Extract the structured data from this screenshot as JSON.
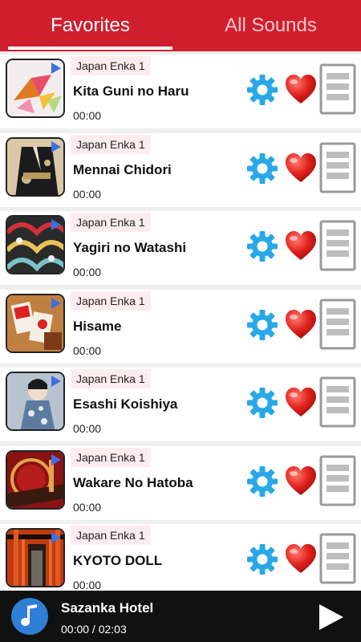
{
  "tabs": [
    {
      "label": "Favorites",
      "active": true
    },
    {
      "label": "All Sounds",
      "active": false
    }
  ],
  "songs": [
    {
      "category": "Japan Enka 1",
      "title": "Kita Guni no Haru",
      "time": "00:00",
      "thumb": "origami-cranes"
    },
    {
      "category": "Japan Enka 1",
      "title": "Mennai Chidori",
      "time": "00:00",
      "thumb": "black-kimono"
    },
    {
      "category": "Japan Enka 1",
      "title": "Yagiri no Watashi",
      "time": "00:00",
      "thumb": "fan-pattern"
    },
    {
      "category": "Japan Enka 1",
      "title": "Hisame",
      "time": "00:00",
      "thumb": "hanafuda-cards"
    },
    {
      "category": "Japan Enka 1",
      "title": "Esashi Koishiya",
      "time": "00:00",
      "thumb": "kimono-woman"
    },
    {
      "category": "Japan Enka 1",
      "title": "Wakare No Hatoba",
      "time": "00:00",
      "thumb": "red-drum"
    },
    {
      "category": "Japan Enka 1",
      "title": "KYOTO DOLL",
      "time": "00:00",
      "thumb": "torii-gates"
    }
  ],
  "player": {
    "title": "Sazanka Hotel",
    "time": "00:00 / 02:03",
    "icon": "music-note-icon"
  },
  "colors": {
    "accent": "#cf1f2e",
    "gear": "#29a8e8",
    "heart": "#e0201b",
    "category_bg": "#fdecef",
    "player_bg": "#111111"
  }
}
